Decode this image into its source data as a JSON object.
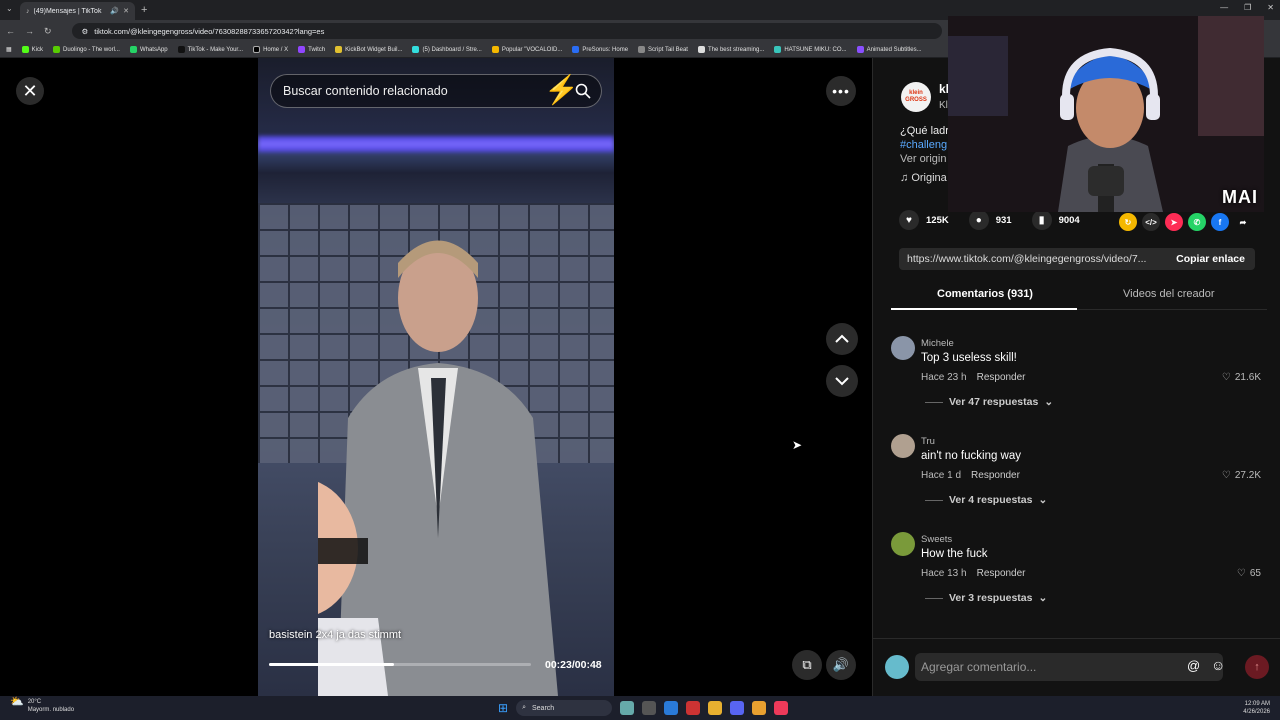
{
  "browser": {
    "tab_title": "(49)Mensajes | TikTok",
    "url": "tiktok.com/@kleingegengross/video/7630828873365720342?lang=es",
    "bookmarks": [
      "Kick",
      "Duolingo - The worl...",
      "WhatsApp",
      "TikTok - Make Your...",
      "Home / X",
      "Twitch",
      "KickBot Widget Buil...",
      "(5) Dashboard / Stre...",
      "Popular \"VOCALOID...",
      "PreSonus: Home",
      "Script Tail Beat",
      "The best streaming...",
      "HATSUNE MIKU: CO...",
      "Animated Subtitles..."
    ]
  },
  "video": {
    "search_placeholder": "Buscar contenido relacionado",
    "caption": "basistein 2x4 ja das stimmt",
    "time": "00:23/00:48",
    "progress_fraction": 0.479
  },
  "panel": {
    "author_avatar_text": "klein GROSS",
    "author_name": "kl",
    "author_nick": "Kl",
    "desc": "¿Qué ladri",
    "desc_tag": "#challeng",
    "desc_more": "Ver origin",
    "music": "Origina",
    "webcam_label": "MAI",
    "likes": "125K",
    "comments_count": "931",
    "saves": "9004",
    "link": "https://www.tiktok.com/@kleingegengross/video/7...",
    "copy_label": "Copiar enlace",
    "tab_comments": "Comentarios (931)",
    "tab_videos": "Videos del creador",
    "reply_label": "Responder",
    "comments": [
      {
        "user": "Michele",
        "text": "Top 3 useless skill!",
        "time": "Hace 23 h",
        "likes": "21.6K",
        "replies": "Ver 47 respuestas"
      },
      {
        "user": "Tru",
        "text": "ain't no fucking way",
        "time": "Hace 1 d",
        "likes": "27.2K",
        "replies": "Ver 4 respuestas"
      },
      {
        "user": "Sweets",
        "text": "How the fuck",
        "time": "Hace 13 h",
        "likes": "65",
        "replies": "Ver 3 respuestas"
      }
    ],
    "comment_placeholder": "Agregar comentario..."
  },
  "taskbar": {
    "temp": "20°C",
    "weather": "Mayorm. nublado",
    "search": "Search",
    "time": "12:09 AM",
    "date": "4/26/2026"
  },
  "colors": {
    "accent_link": "#5aa9ff",
    "send_button": "#6b1a22"
  }
}
